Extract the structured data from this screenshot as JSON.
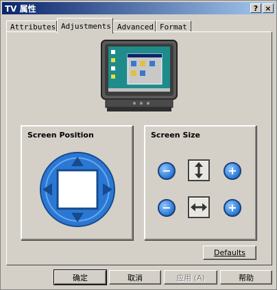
{
  "window": {
    "title": "TV 属性",
    "help_label": "?",
    "close_label": "×"
  },
  "tabs": [
    {
      "label": "Attributes",
      "active": false
    },
    {
      "label": "Adjustments",
      "active": true
    },
    {
      "label": "Advanced",
      "active": false
    },
    {
      "label": "Format",
      "active": false
    }
  ],
  "groups": {
    "screen_position": {
      "title": "Screen Position"
    },
    "screen_size": {
      "title": "Screen Size"
    }
  },
  "size_controls": {
    "minus_label": "−",
    "plus_label": "+"
  },
  "defaults_button": "Defaults",
  "footer": {
    "ok": "确定",
    "cancel": "取消",
    "apply": "应用 (A)",
    "help": "帮助"
  },
  "colors": {
    "accent": "#2b78d4",
    "titlebar": "#0a246a"
  }
}
